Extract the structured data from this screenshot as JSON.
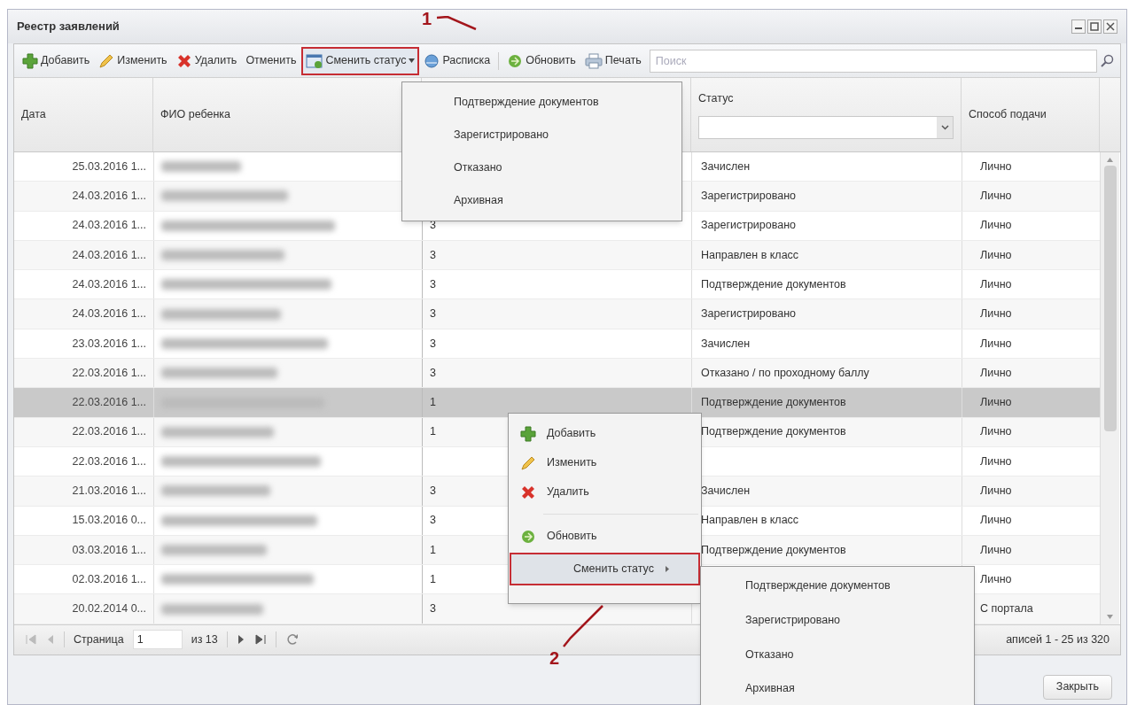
{
  "window": {
    "title": "Реестр заявлений"
  },
  "toolbar": [
    {
      "kind": "add",
      "label": "Добавить",
      "outlined": false
    },
    {
      "kind": "edit",
      "label": "Изменить",
      "outlined": false
    },
    {
      "kind": "delete",
      "label": "Удалить",
      "outlined": false
    },
    {
      "kind": "plain",
      "label": "Отменить",
      "outlined": false
    },
    {
      "kind": "status",
      "label": "Сменить статус",
      "outlined": true
    },
    {
      "kind": "receipt",
      "label": "Расписка",
      "outlined": false
    },
    {
      "kind": "separator"
    },
    {
      "kind": "refresh",
      "label": "Обновить",
      "outlined": false
    },
    {
      "kind": "print",
      "label": "Печать",
      "outlined": false
    }
  ],
  "search": {
    "placeholder": "Поиск"
  },
  "table": {
    "columns": [
      {
        "label": "Дата"
      },
      {
        "label": "ФИО ребенка"
      },
      {},
      {
        "label": "Статус",
        "filter": true
      },
      {
        "label": "Способ подачи"
      }
    ],
    "rows": [
      {
        "date": "25.03.2016 1...",
        "status": "Зачислен",
        "method": "Лично",
        "selected": false
      },
      {
        "date": "24.03.2016 1...",
        "status": "Зарегистрировано",
        "method": "Лично",
        "selected": false
      },
      {
        "date": "24.03.2016 1...",
        "number": "3",
        "status": "Зарегистрировано",
        "method": "Лично",
        "selected": false
      },
      {
        "date": "24.03.2016 1...",
        "number": "3",
        "status": "Направлен в класс",
        "method": "Лично",
        "selected": false
      },
      {
        "date": "24.03.2016 1...",
        "number": "3",
        "status": "Подтверждение документов",
        "method": "Лично",
        "selected": false
      },
      {
        "date": "24.03.2016 1...",
        "number": "3",
        "status": "Зарегистрировано",
        "method": "Лично",
        "selected": false
      },
      {
        "date": "23.03.2016 1...",
        "number": "3",
        "status": "Зачислен",
        "method": "Лично",
        "selected": false
      },
      {
        "date": "22.03.2016 1...",
        "number": "3",
        "status": "Отказано / по проходному баллу",
        "method": "Лично",
        "selected": false
      },
      {
        "date": "22.03.2016 1...",
        "number": "1",
        "status": "Подтверждение документов",
        "method": "Лично",
        "selected": true
      },
      {
        "date": "22.03.2016 1...",
        "number": "1",
        "status": "Подтверждение документов",
        "method": "Лично",
        "selected": false
      },
      {
        "date": "22.03.2016 1...",
        "method": "Лично",
        "selected": false
      },
      {
        "date": "21.03.2016 1...",
        "number": "3",
        "status": "Зачислен",
        "method": "Лично",
        "selected": false
      },
      {
        "date": "15.03.2016 0...",
        "number": "3",
        "status": "Направлен в класс",
        "method": "Лично",
        "selected": false
      },
      {
        "date": "03.03.2016 1...",
        "number": "1",
        "status": "Подтверждение документов",
        "method": "Лично",
        "selected": false
      },
      {
        "date": "02.03.2016 1...",
        "number": "1",
        "method": "Лично",
        "selected": false
      },
      {
        "date": "20.02.2014 0...",
        "number": "3",
        "method": "С портала",
        "selected": false
      }
    ]
  },
  "pager": {
    "label": "Страница",
    "page": "1",
    "total": "из 13",
    "summary": "аписей 1 - 25 из 320"
  },
  "close_button": "Закрыть",
  "dropdown": [
    "Подтверждение документов",
    "Зарегистрировано",
    "Отказано",
    "Архивная"
  ],
  "context_menu": [
    {
      "kind": "add",
      "label": "Добавить",
      "selected": false,
      "outlined": false
    },
    {
      "kind": "edit",
      "label": "Изменить",
      "selected": false,
      "outlined": false
    },
    {
      "kind": "delete",
      "label": "Удалить",
      "selected": false,
      "outlined": false
    },
    {
      "kind": "refresh",
      "label": "Обновить",
      "selected": false,
      "outlined": false
    },
    {
      "kind": "submenu",
      "label": "Сменить статус",
      "selected": true,
      "outlined": true
    }
  ],
  "submenu": [
    "Подтверждение документов",
    "Зарегистрировано",
    "Отказано",
    "Архивная"
  ],
  "annotations": [
    "1",
    "2"
  ]
}
